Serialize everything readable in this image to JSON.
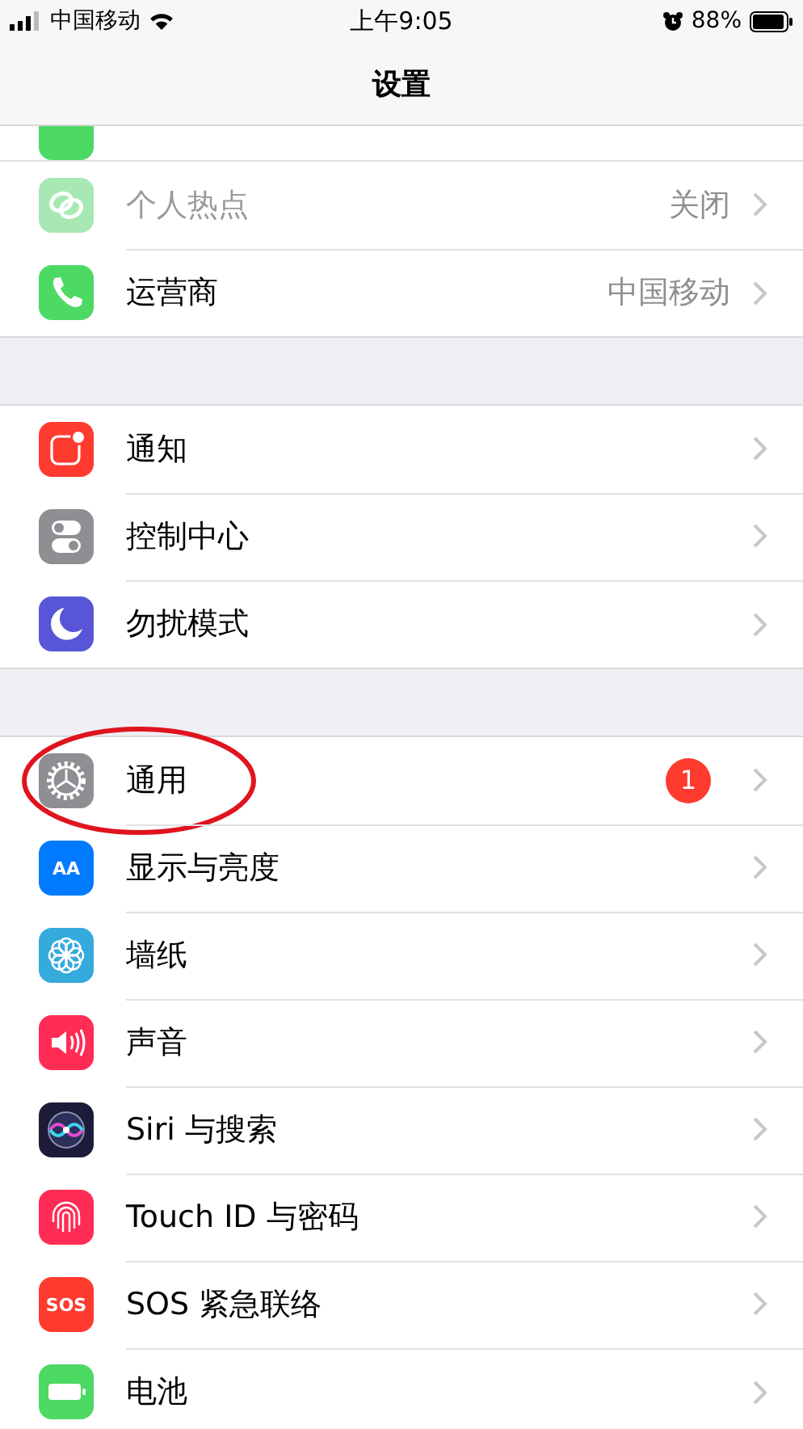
{
  "status_bar": {
    "carrier": "中国移动",
    "time": "上午9:05",
    "battery": "88%"
  },
  "nav": {
    "title": "设置"
  },
  "groups": [
    {
      "partial_row": {
        "color": "#4cd964"
      },
      "rows": [
        {
          "kind": "hotspot",
          "color": "#a8e8b4",
          "label": "个人热点",
          "value": "关闭",
          "disabled": true
        },
        {
          "kind": "phone",
          "color": "#4cd964",
          "label": "运营商",
          "value": "中国移动",
          "disabled": false
        }
      ]
    },
    {
      "rows": [
        {
          "kind": "notifications",
          "color": "#ff3b30",
          "label": "通知",
          "disabled": false
        },
        {
          "kind": "control",
          "color": "#8e8e93",
          "label": "控制中心",
          "disabled": false
        },
        {
          "kind": "moon",
          "color": "#5856d6",
          "label": "勿扰模式",
          "disabled": false
        }
      ]
    },
    {
      "rows": [
        {
          "kind": "gear",
          "color": "#8e8e93",
          "label": "通用",
          "badge": "1",
          "annotation": {
            "kind": "ellipse",
            "color": "#e0141e"
          },
          "disabled": false
        },
        {
          "kind": "glyph",
          "color": "#007aff",
          "icon_text": "AA",
          "label": "显示与亮度",
          "disabled": false
        },
        {
          "kind": "flower",
          "color": "#35aadc",
          "label": "墙纸",
          "disabled": false
        },
        {
          "kind": "speaker",
          "color": "#ff2d55",
          "label": "声音",
          "disabled": false
        },
        {
          "kind": "siri",
          "color": "#1c1c3a",
          "label": "Siri 与搜索",
          "disabled": false
        },
        {
          "kind": "fingerprint",
          "color": "#ff2d55",
          "label": "Touch ID 与密码",
          "disabled": false
        },
        {
          "kind": "glyph",
          "color": "#ff3b30",
          "icon_text": "SOS",
          "label": "SOS 紧急联络",
          "disabled": false
        },
        {
          "kind": "battery",
          "color": "#4cd964",
          "label": "电池",
          "disabled": false
        }
      ]
    }
  ]
}
